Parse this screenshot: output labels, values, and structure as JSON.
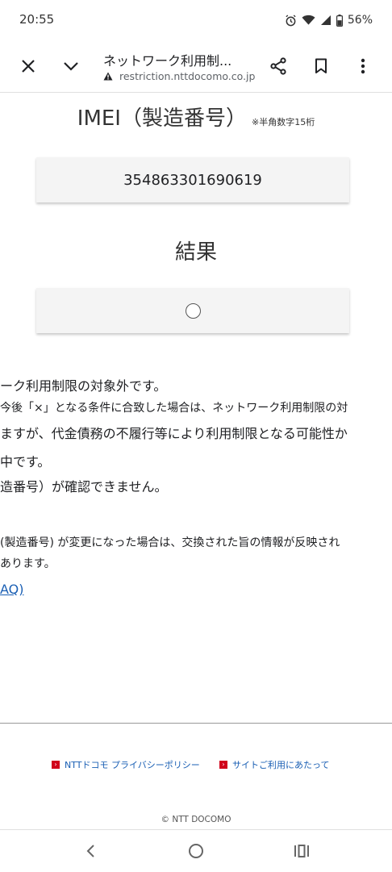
{
  "status_bar": {
    "time": "20:55",
    "battery": "56%",
    "icons": [
      "alarm-icon",
      "wifi-icon",
      "signal-icon",
      "battery-icon"
    ]
  },
  "toolbar": {
    "title": "ネットワーク利用制...",
    "url": "restriction.nttdocomo.co.jp",
    "icons": [
      "close-icon",
      "chevron-down-icon",
      "share-icon",
      "bookmark-icon",
      "more-vert-icon"
    ]
  },
  "imei": {
    "title": "IMEI（製造番号）",
    "note": "※半角数字15桁",
    "value": "354863301690619"
  },
  "result": {
    "title": "結果",
    "symbol": "○"
  },
  "messages": {
    "line1": "ーク利用制限の対象外です。",
    "line2": "今後「×」となる条件に合致した場合は、ネットワーク利用制限の対",
    "line3": "ますが、代金債務の不履行等により利用制限となる可能性か",
    "line4": "中です。",
    "line5": "造番号）が確認できません。",
    "line6": "(製造番号) が変更になった場合は、交換された旨の情報が反映され",
    "line7": "あります。",
    "faq": "AQ)"
  },
  "footer": {
    "privacy": "NTTドコモ プライバシーポリシー",
    "terms": "サイトご利用にあたって",
    "copyright": "© NTT DOCOMO"
  },
  "colors": {
    "link": "#1a5fb4",
    "footer_icon": "#d0021b",
    "box_bg": "#f4f4f4"
  }
}
